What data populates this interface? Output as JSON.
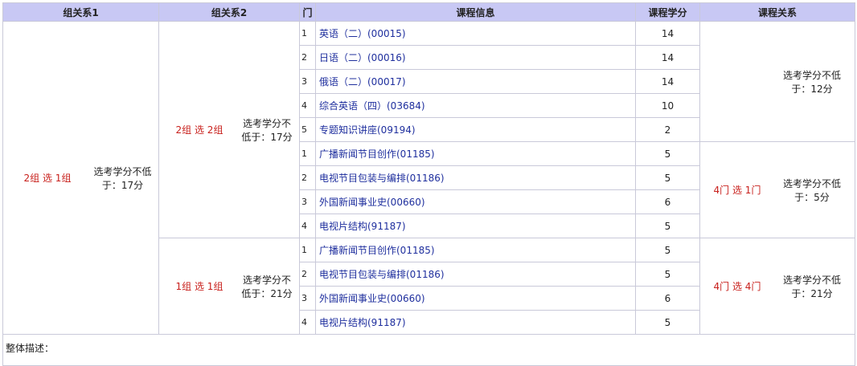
{
  "headers": {
    "group_rel_1": "组关系1",
    "group_rel_2": "组关系2",
    "door": "门",
    "course_info": "课程信息",
    "course_credit": "课程学分",
    "course_rel": "课程关系"
  },
  "level1": {
    "select": "2组 选 1组",
    "min_credit": "选考学分不低于：17分"
  },
  "groups": [
    {
      "select": "2组 选 2组",
      "min_credit": "选考学分不低于：17分",
      "subgroups": [
        {
          "select": "",
          "min_credit": "选考学分不低于：12分",
          "courses": [
            {
              "num": "1",
              "name": "英语（二）(00015)",
              "credit": "14"
            },
            {
              "num": "2",
              "name": "日语（二）(00016)",
              "credit": "14"
            },
            {
              "num": "3",
              "name": "俄语（二）(00017)",
              "credit": "14"
            },
            {
              "num": "4",
              "name": "综合英语（四）(03684)",
              "credit": "10"
            },
            {
              "num": "5",
              "name": "专题知识讲座(09194)",
              "credit": "2"
            }
          ]
        },
        {
          "select": "4门 选 1门",
          "min_credit": "选考学分不低于：5分",
          "courses": [
            {
              "num": "1",
              "name": "广播新闻节目创作(01185)",
              "credit": "5"
            },
            {
              "num": "2",
              "name": "电视节目包装与编排(01186)",
              "credit": "5"
            },
            {
              "num": "3",
              "name": "外国新闻事业史(00660)",
              "credit": "6"
            },
            {
              "num": "4",
              "name": "电视片结构(91187)",
              "credit": "5"
            }
          ]
        }
      ]
    },
    {
      "select": "1组 选 1组",
      "min_credit": "选考学分不低于：21分",
      "subgroups": [
        {
          "select": "4门 选 4门",
          "min_credit": "选考学分不低于：21分",
          "courses": [
            {
              "num": "1",
              "name": "广播新闻节目创作(01185)",
              "credit": "5"
            },
            {
              "num": "2",
              "name": "电视节目包装与编排(01186)",
              "credit": "5"
            },
            {
              "num": "3",
              "name": "外国新闻事业史(00660)",
              "credit": "6"
            },
            {
              "num": "4",
              "name": "电视片结构(91187)",
              "credit": "5"
            }
          ]
        }
      ]
    }
  ],
  "footer": {
    "overall_desc": "整体描述："
  }
}
